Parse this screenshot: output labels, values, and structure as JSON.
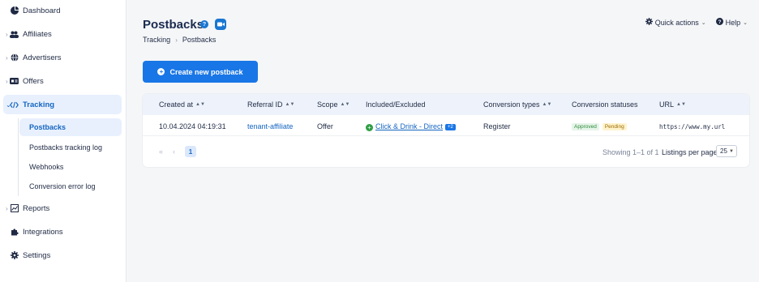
{
  "sidebar": {
    "items": [
      {
        "label": "Dashboard",
        "icon": "pie-chart-icon"
      },
      {
        "label": "Affiliates",
        "icon": "users-icon"
      },
      {
        "label": "Advertisers",
        "icon": "globe-icon"
      },
      {
        "label": "Offers",
        "icon": "tag-icon"
      },
      {
        "label": "Tracking",
        "icon": "code-icon"
      },
      {
        "label": "Reports",
        "icon": "report-icon"
      },
      {
        "label": "Integrations",
        "icon": "puzzle-icon"
      },
      {
        "label": "Settings",
        "icon": "gear-icon"
      }
    ],
    "tracking_sub": [
      "Postbacks",
      "Postbacks tracking log",
      "Webhooks",
      "Conversion error log"
    ]
  },
  "header": {
    "title": "Postbacks",
    "breadcrumb": [
      "Tracking",
      "Postbacks"
    ],
    "quick_actions": "Quick actions",
    "help": "Help",
    "help_badge": "?"
  },
  "create_button": "Create new postback",
  "table": {
    "columns": [
      "Created at",
      "Referral ID",
      "Scope",
      "Included/Excluded",
      "Conversion types",
      "Conversion statuses",
      "URL"
    ],
    "rows": [
      {
        "created_at": "10.04.2024 04:19:31",
        "referral_id": "tenant-affiliate",
        "scope": "Offer",
        "included": "Click & Drink - Direct",
        "included_more": "+2",
        "conversion_type": "Register",
        "statuses": [
          "Approved",
          "Pending"
        ],
        "url": "https://www.my.url"
      }
    ]
  },
  "pagination": {
    "first": "«",
    "prev": "‹",
    "current": "1",
    "showing": "Showing 1–1 of 1",
    "per_page_label": "Listings per page",
    "per_page_value": "25"
  },
  "colors": {
    "accent": "#1976e6",
    "active_bg": "#e8f0fe",
    "approved": "#2e8b3d",
    "pending": "#9a6b00"
  }
}
